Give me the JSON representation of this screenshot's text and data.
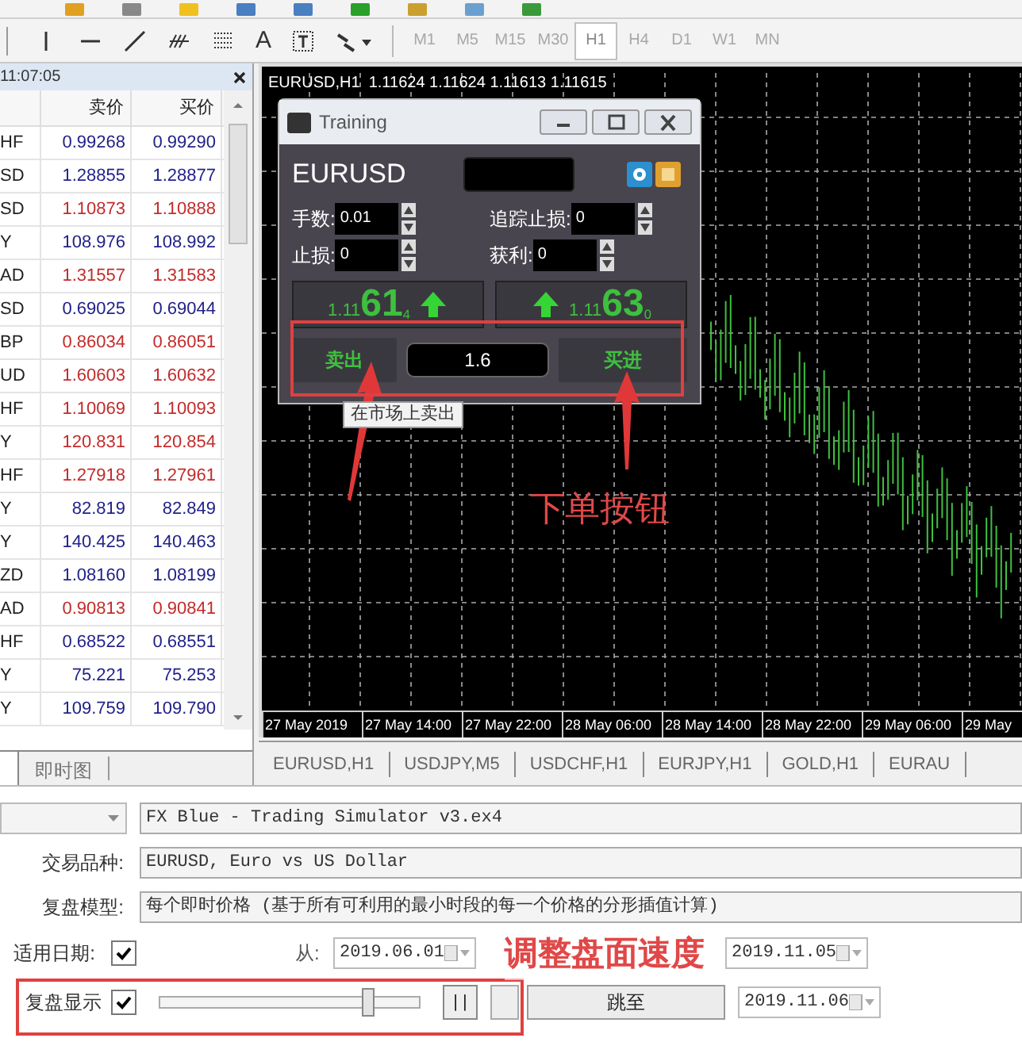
{
  "toolbar": {
    "text_tool": "A",
    "timeframes": [
      {
        "label": "M1",
        "selected": false
      },
      {
        "label": "M5",
        "selected": false
      },
      {
        "label": "M15",
        "selected": false
      },
      {
        "label": "M30",
        "selected": false
      },
      {
        "label": "H1",
        "selected": true
      },
      {
        "label": "H4",
        "selected": false
      },
      {
        "label": "D1",
        "selected": false
      },
      {
        "label": "W1",
        "selected": false
      },
      {
        "label": "MN",
        "selected": false
      }
    ]
  },
  "market_watch": {
    "time": "11:07:05",
    "columns": [
      "卖价",
      "买价"
    ],
    "rows": [
      {
        "symbol": "HF",
        "bid": "0.99268",
        "ask": "0.99290",
        "color": "#22228a"
      },
      {
        "symbol": "SD",
        "bid": "1.28855",
        "ask": "1.28877",
        "color": "#22228a"
      },
      {
        "symbol": "SD",
        "bid": "1.10873",
        "ask": "1.10888",
        "color": "#c42b2b"
      },
      {
        "symbol": "Y",
        "bid": "108.976",
        "ask": "108.992",
        "color": "#22228a"
      },
      {
        "symbol": "AD",
        "bid": "1.31557",
        "ask": "1.31583",
        "color": "#c42b2b"
      },
      {
        "symbol": "SD",
        "bid": "0.69025",
        "ask": "0.69044",
        "color": "#22228a"
      },
      {
        "symbol": "BP",
        "bid": "0.86034",
        "ask": "0.86051",
        "color": "#c42b2b"
      },
      {
        "symbol": "UD",
        "bid": "1.60603",
        "ask": "1.60632",
        "color": "#c42b2b"
      },
      {
        "symbol": "HF",
        "bid": "1.10069",
        "ask": "1.10093",
        "color": "#c42b2b"
      },
      {
        "symbol": "Y",
        "bid": "120.831",
        "ask": "120.854",
        "color": "#c42b2b"
      },
      {
        "symbol": "HF",
        "bid": "1.27918",
        "ask": "1.27961",
        "color": "#c42b2b"
      },
      {
        "symbol": "Y",
        "bid": "82.819",
        "ask": "82.849",
        "color": "#22228a"
      },
      {
        "symbol": "Y",
        "bid": "140.425",
        "ask": "140.463",
        "color": "#22228a"
      },
      {
        "symbol": "ZD",
        "bid": "1.08160",
        "ask": "1.08199",
        "color": "#22228a"
      },
      {
        "symbol": "AD",
        "bid": "0.90813",
        "ask": "0.90841",
        "color": "#c42b2b"
      },
      {
        "symbol": "HF",
        "bid": "0.68522",
        "ask": "0.68551",
        "color": "#22228a"
      },
      {
        "symbol": "Y",
        "bid": "75.221",
        "ask": "75.253",
        "color": "#22228a"
      },
      {
        "symbol": "Y",
        "bid": "109.759",
        "ask": "109.790",
        "color": "#22228a"
      }
    ],
    "tabs": [
      "即时图"
    ]
  },
  "chart": {
    "title": "EURUSD,H1  1.11624 1.11624 1.11613 1.11615",
    "time_labels": [
      "27 May 2019",
      "27 May 14:00",
      "27 May 22:00",
      "28 May 06:00",
      "28 May 14:00",
      "28 May 22:00",
      "29 May 06:00",
      "29 May"
    ],
    "tabs": [
      "EURUSD,H1",
      "USDJPY,M5",
      "USDCHF,H1",
      "EURJPY,H1",
      "GOLD,H1",
      "EURAU"
    ]
  },
  "training_dialog": {
    "title": "Training",
    "symbol": "EURUSD",
    "fields": [
      {
        "label": "手数:",
        "value": "0.01"
      },
      {
        "label": "追踪止损:",
        "value": "0"
      },
      {
        "label": "止损:",
        "value": "0"
      },
      {
        "label": "获利:",
        "value": "0"
      }
    ],
    "sell": {
      "price": "1.11**61**$_{4}$",
      "label": "卖出"
    },
    "buy": {
      "price": "1.11**63**$_{0}$",
      "label": "买进"
    },
    "volume": "1.6",
    "tooltip": "在市场上卖出"
  },
  "tester": {
    "expert": "FX Blue - Trading Simulator v3.ex4",
    "symbol_label": "交易品种:",
    "symbol": "EURUSD, Euro vs US Dollar",
    "model_label": "复盘模型:",
    "model": "每个即时价格 (基于所有可利用的最小时段的每一个价格的分形插值计算)",
    "use_date_label": "适用日期:",
    "use_date": true,
    "from_label": "从:",
    "from": "2019.06.01",
    "to": "2019.11.05",
    "visual_label": "复盘显示",
    "visual": true,
    "speed": {
      "level": 0.8
    },
    "pause": "| |",
    "skip_button": "跳至",
    "skip_to": "2019.11.06"
  },
  "annotations": [
    "下单按钮",
    "调整盘面速度"
  ]
}
